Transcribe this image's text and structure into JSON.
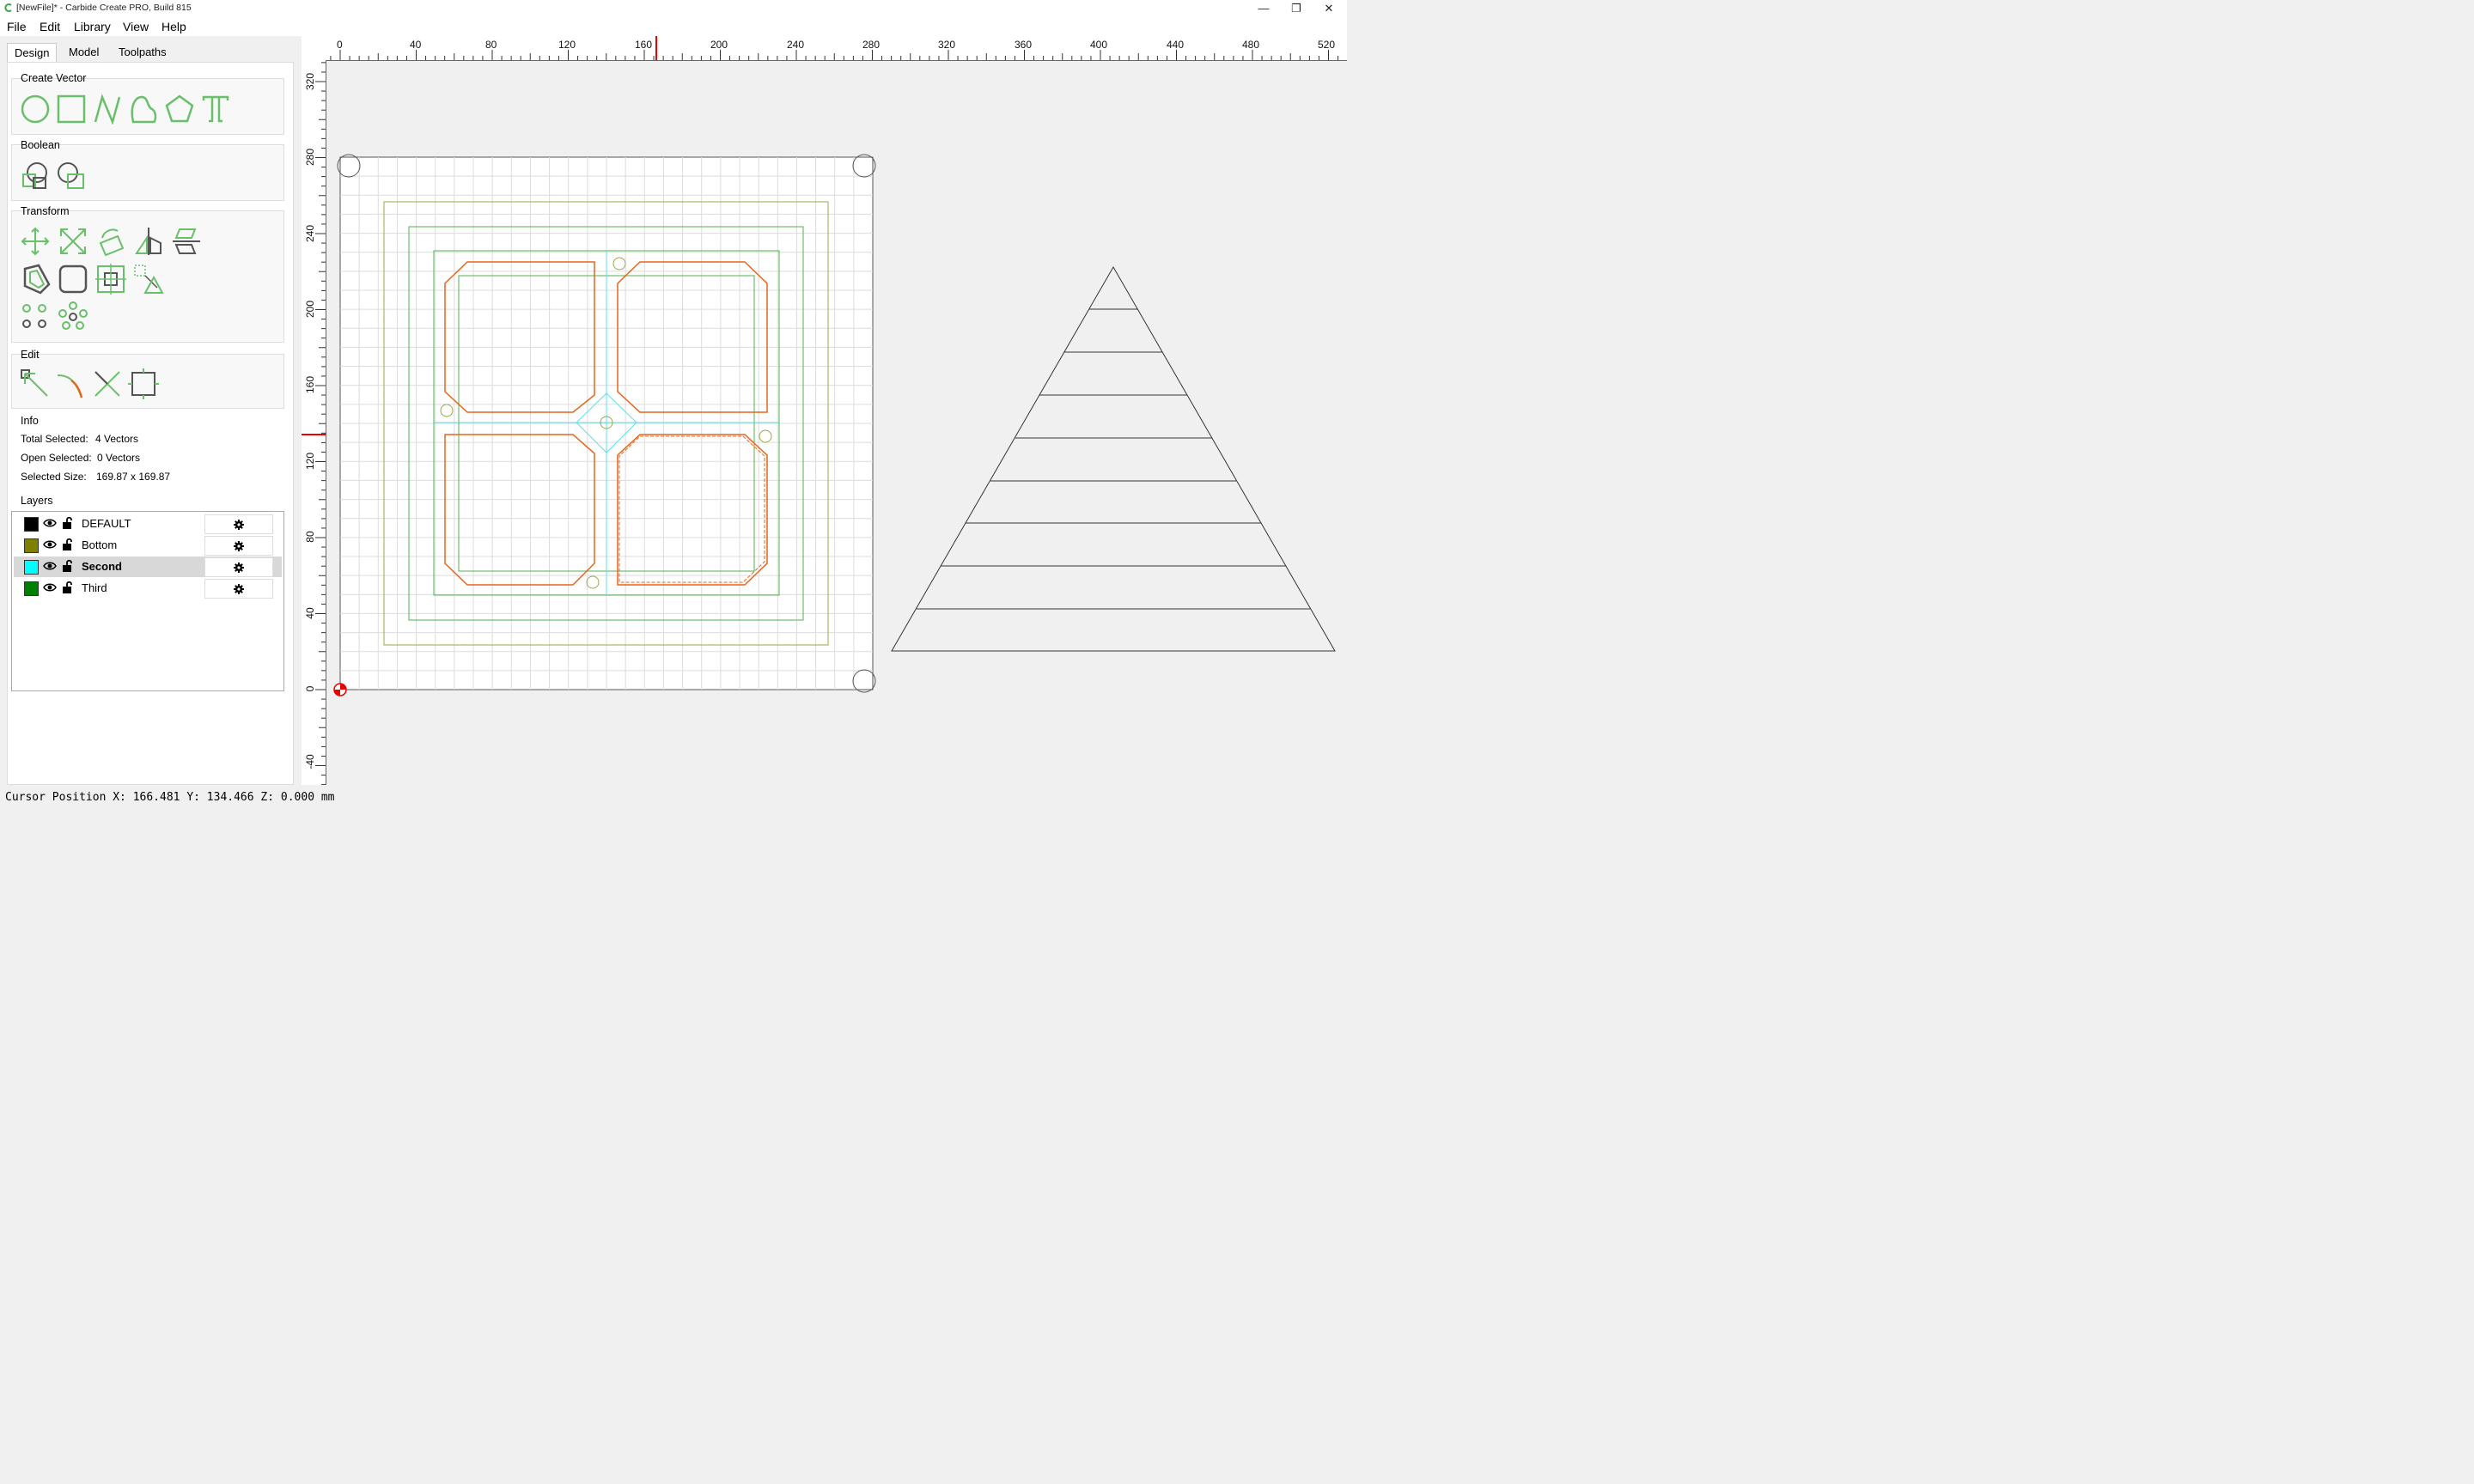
{
  "window": {
    "title": "[NewFile]* - Carbide Create PRO, Build 815",
    "minimize_glyph": "—",
    "restore_glyph": "❐",
    "close_glyph": "✕"
  },
  "menu": {
    "file": "File",
    "edit": "Edit",
    "library": "Library",
    "view": "View",
    "help": "Help"
  },
  "tabs": {
    "design": "Design",
    "model": "Model",
    "toolpaths": "Toolpaths"
  },
  "groups": {
    "create_vector": "Create Vector",
    "boolean": "Boolean",
    "transform": "Transform",
    "edit": "Edit",
    "info": "Info",
    "layers": "Layers"
  },
  "info": {
    "total_selected_label": "Total Selected:",
    "total_selected_value": "4 Vectors",
    "open_selected_label": "Open Selected:",
    "open_selected_value": "0 Vectors",
    "selected_size_label": "Selected Size:",
    "selected_size_value": "169.87 x 169.87"
  },
  "layers": [
    {
      "name": "DEFAULT",
      "color": "#000000",
      "selected": false
    },
    {
      "name": "Bottom",
      "color": "#808000",
      "selected": false
    },
    {
      "name": "Second",
      "color": "#00ffff",
      "selected": true
    },
    {
      "name": "Third",
      "color": "#008000",
      "selected": false
    }
  ],
  "ruler": {
    "x_labels": [
      "0",
      "40",
      "80",
      "120",
      "160",
      "200",
      "240",
      "280",
      "320",
      "360",
      "400",
      "440",
      "480",
      "520"
    ],
    "y_labels": [
      "320",
      "280",
      "240",
      "200",
      "160",
      "120",
      "80",
      "40",
      "0",
      "-40"
    ]
  },
  "status": {
    "cursor_position": "Cursor Position X: 166.481 Y: 134.466 Z: 0.000 mm"
  },
  "colors": {
    "accent_green": "#6abf6a",
    "toolpath_orange": "#e8651d",
    "layer_cyan": "#5fe0e8",
    "layer_olive": "#9aa84a",
    "layer_green": "#4fb34f"
  }
}
